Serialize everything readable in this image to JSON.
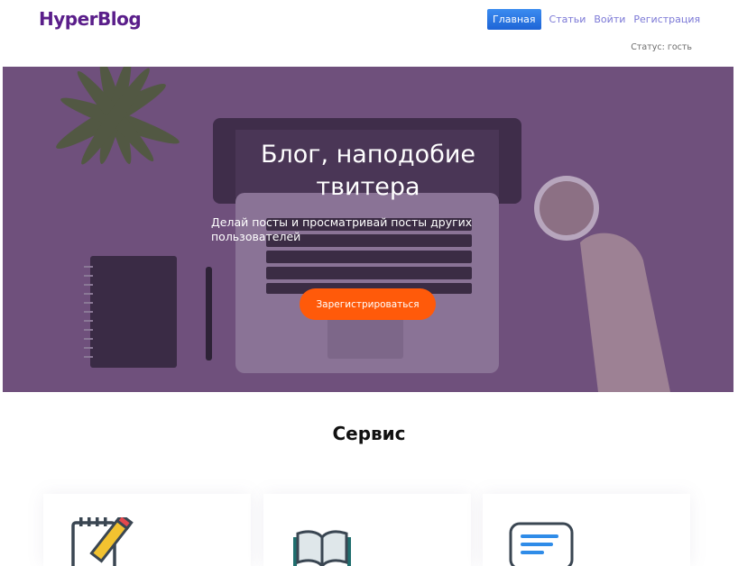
{
  "header": {
    "logo": "HyperBlog",
    "nav": [
      {
        "label": "Главная",
        "active": true
      },
      {
        "label": "Статьи",
        "active": false
      },
      {
        "label": "Войти",
        "active": false
      },
      {
        "label": "Регистрация",
        "active": false
      }
    ],
    "status": "Статус: гость"
  },
  "hero": {
    "title_line1": "Блог, наподобие",
    "title_line2": "твитера",
    "subtitle_line1": "Делай посты и просматривай посты других",
    "subtitle_line2": "пользователей",
    "cta_label": "Зарегистрироваться",
    "overlay_color": "#6d4e7a"
  },
  "services": {
    "title": "Сервис",
    "cards": [
      {
        "icon": "notepad-pencil-icon"
      },
      {
        "icon": "open-book-icon"
      },
      {
        "icon": "chat-bubble-icon"
      }
    ]
  },
  "colors": {
    "brand": "#5a1e8a",
    "nav_link": "#7b78d6",
    "nav_active": "#2f7be8",
    "cta": "#ff5a0a"
  }
}
